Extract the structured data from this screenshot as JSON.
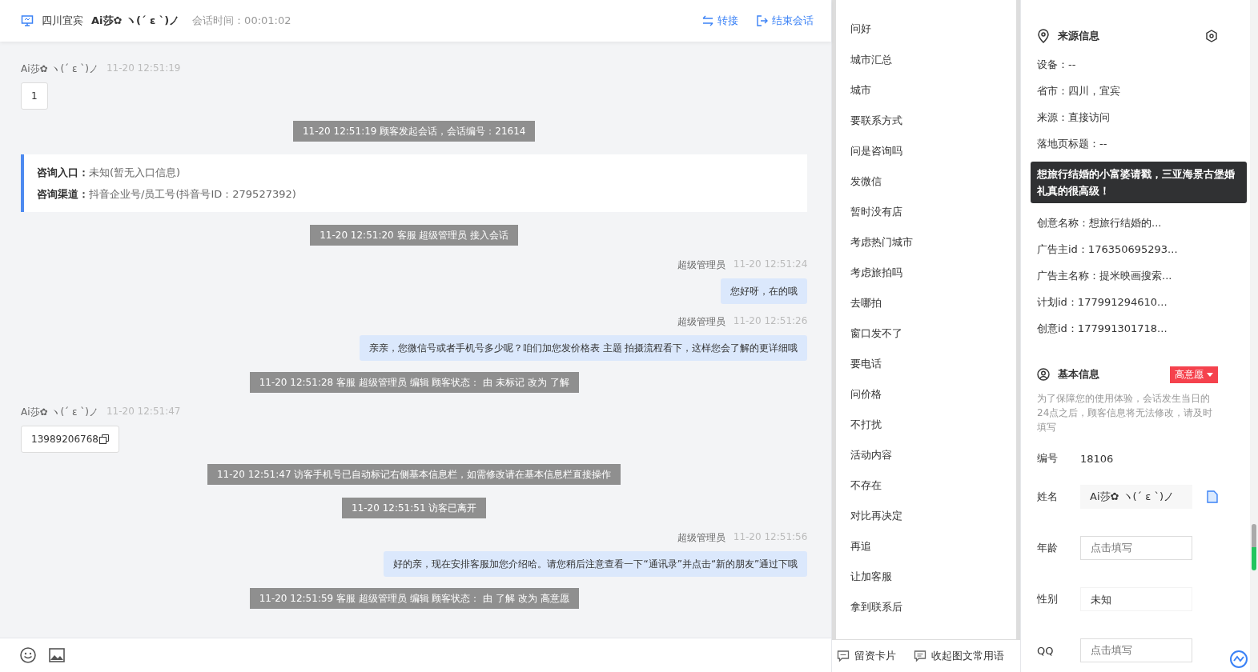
{
  "header": {
    "location": "四川宜宾",
    "visitor": "Ai莎✿ ヽ(ˊ ε ˋ)ノ",
    "session_time": "会话时间：00:01:02",
    "actions": [
      {
        "kind": "transfer",
        "label": "转接"
      },
      {
        "kind": "end",
        "label": "结束会话"
      }
    ]
  },
  "messages": [
    {
      "kind": "visitor",
      "sender": "Ai莎✿ ヽ(ˊ ε ˋ)ノ",
      "time": "11-20 12:51:19",
      "text": "1"
    },
    {
      "kind": "system",
      "text": "11-20 12:51:19 顾客发起会话，会话编号：21614"
    },
    {
      "kind": "source_card",
      "lines": [
        {
          "label": "咨询入口：",
          "value": "未知(暂无入口信息)"
        },
        {
          "label": "咨询渠道：",
          "value": "抖音企业号/员工号(抖音号ID：279527392)"
        }
      ]
    },
    {
      "kind": "system",
      "text": "11-20 12:51:20 客服 超级管理员 接入会话"
    },
    {
      "kind": "agent",
      "sender": "超级管理员",
      "time": "11-20 12:51:24",
      "text": "您好呀，在的哦"
    },
    {
      "kind": "agent",
      "sender": "超级管理员",
      "time": "11-20 12:51:26",
      "text": "亲亲，您微信号或者手机号多少呢？咱们加您发价格表 主题 拍摄流程看下，这样您会了解的更详细哦"
    },
    {
      "kind": "system",
      "text": "11-20 12:51:28 客服 超级管理员 编辑 顾客状态： 由 未标记 改为 了解"
    },
    {
      "kind": "visitor",
      "sender": "Ai莎✿ ヽ(ˊ ε ˋ)ノ",
      "time": "11-20 12:51:47",
      "text": "13989206768",
      "copyable": true
    },
    {
      "kind": "system",
      "text": "11-20 12:51:47 访客手机号已自动标记右侧基本信息栏，如需修改请在基本信息栏直接操作"
    },
    {
      "kind": "system",
      "text": "11-20 12:51:51 访客已离开"
    },
    {
      "kind": "agent",
      "sender": "超级管理员",
      "time": "11-20 12:51:56",
      "text": "好的亲，现在安排客服加您介绍哈。请您稍后注意查看一下“通讯录”并点击“新的朋友”通过下哦"
    },
    {
      "kind": "system",
      "text": "11-20 12:51:59 客服 超级管理员 编辑 顾客状态： 由 了解 改为 高意愿"
    }
  ],
  "input_tools": [
    {
      "kind": "emoji"
    },
    {
      "kind": "image"
    }
  ],
  "quick_replies": [
    "问好",
    "城市汇总",
    "城市",
    "要联系方式",
    "问是咨询吗",
    "发微信",
    "暂时没有店",
    "考虑热门城市",
    "考虑旅拍吗",
    "去哪拍",
    "窗口发不了",
    "要电话",
    "问价格",
    "不打扰",
    "活动内容",
    "不存在",
    "对比再决定",
    "再追",
    "让加客服",
    "拿到联系后"
  ],
  "quick_footer": [
    {
      "kind": "card",
      "label": "留资卡片"
    },
    {
      "kind": "collapse",
      "label": "收起图文常用语"
    }
  ],
  "source_info": {
    "title": "来源信息",
    "rows_before": [
      "设备：--",
      "省市：四川，宜宾",
      "来源：直接访问",
      "落地页标题：--"
    ],
    "tooltip": "想旅行结婚的小富婆请戳，三亚海景古堡婚礼真的很高级！",
    "rows_after": [
      "创意名称：想旅行结婚的...",
      "广告主id：176350695293...",
      "广告主名称：提米映画搜索...",
      "计划id：177991294610...",
      "创意id：177991301718..."
    ]
  },
  "basic_info": {
    "title": "基本信息",
    "status": {
      "label": "高意愿",
      "color": "#f5424d"
    },
    "notice": "为了保障您的使用体验，会话发生当日的24点之后，顾客信息将无法修改，请及时填写",
    "fields": [
      {
        "kind": "text",
        "label": "编号",
        "value": "18106"
      },
      {
        "kind": "readonly",
        "label": "姓名",
        "value": "Ai莎✿ ヽ(ˊ ε ˋ)ノ",
        "copy": true
      },
      {
        "kind": "input",
        "label": "年龄",
        "placeholder": "点击填写"
      },
      {
        "kind": "select",
        "label": "性别",
        "value": "未知"
      },
      {
        "kind": "input",
        "label": "QQ",
        "placeholder": "点击填写"
      }
    ]
  }
}
